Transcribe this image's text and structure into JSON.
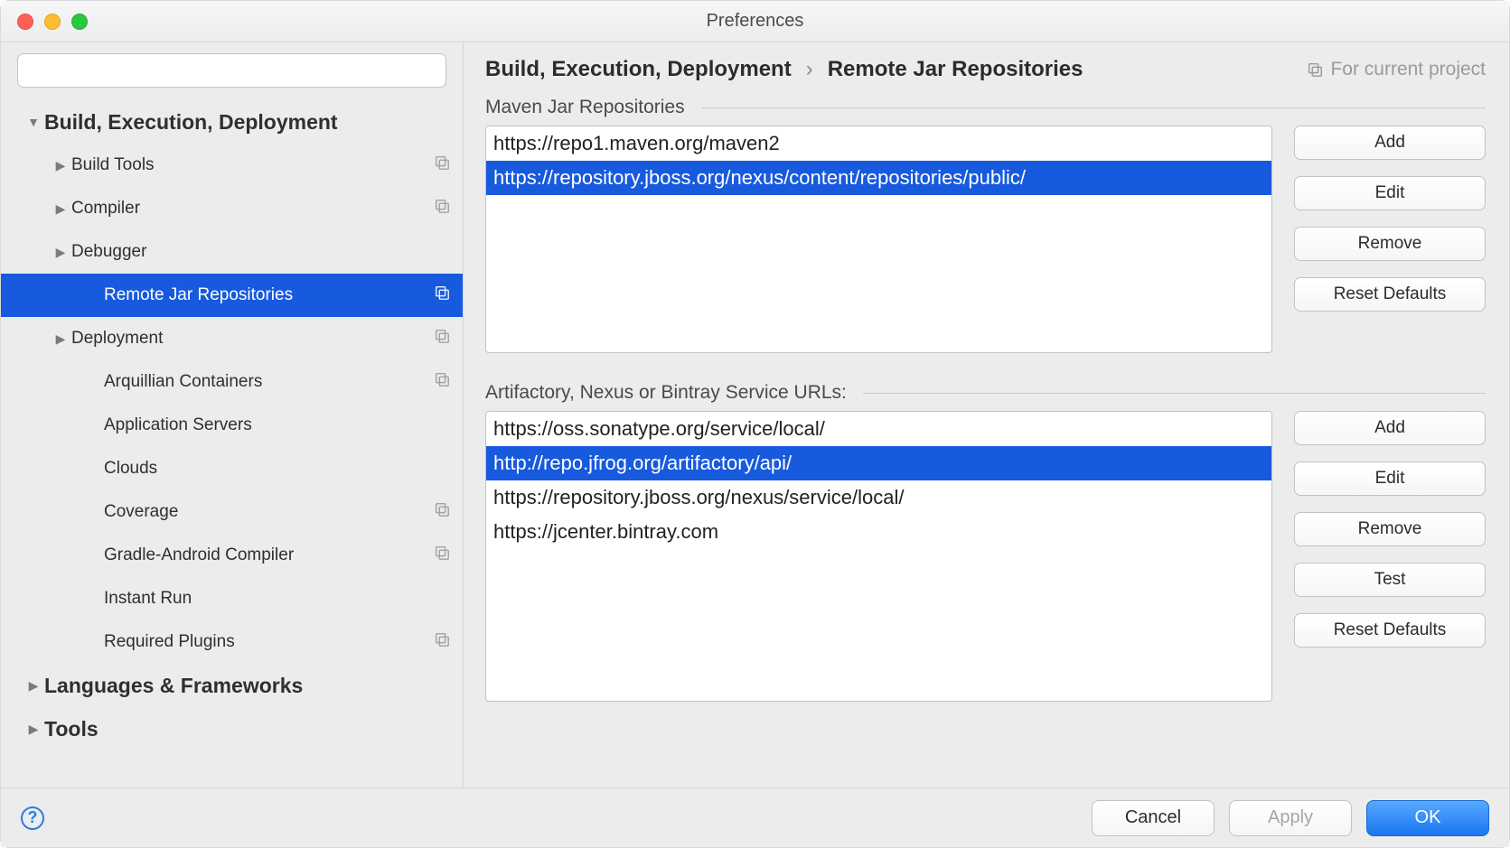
{
  "window": {
    "title": "Preferences"
  },
  "search": {
    "placeholder": ""
  },
  "sidebar": {
    "items": [
      {
        "label": "Build, Execution, Deployment",
        "bold": true,
        "expanded": true,
        "level": 0,
        "arrow": "down",
        "copy": false
      },
      {
        "label": "Build Tools",
        "level": 1,
        "arrow": "right",
        "copy": true
      },
      {
        "label": "Compiler",
        "level": 1,
        "arrow": "right",
        "copy": true
      },
      {
        "label": "Debugger",
        "level": 1,
        "arrow": "right",
        "copy": false
      },
      {
        "label": "Remote Jar Repositories",
        "level": 2,
        "arrow": "",
        "copy": true,
        "selected": true
      },
      {
        "label": "Deployment",
        "level": 1,
        "arrow": "right",
        "copy": true
      },
      {
        "label": "Arquillian Containers",
        "level": 2,
        "arrow": "",
        "copy": true
      },
      {
        "label": "Application Servers",
        "level": 2,
        "arrow": "",
        "copy": false
      },
      {
        "label": "Clouds",
        "level": 2,
        "arrow": "",
        "copy": false
      },
      {
        "label": "Coverage",
        "level": 2,
        "arrow": "",
        "copy": true
      },
      {
        "label": "Gradle-Android Compiler",
        "level": 2,
        "arrow": "",
        "copy": true
      },
      {
        "label": "Instant Run",
        "level": 2,
        "arrow": "",
        "copy": false
      },
      {
        "label": "Required Plugins",
        "level": 2,
        "arrow": "",
        "copy": true
      },
      {
        "label": "Languages & Frameworks",
        "bold": true,
        "level": 0,
        "arrow": "right",
        "copy": false
      },
      {
        "label": "Tools",
        "bold": true,
        "level": 0,
        "arrow": "right",
        "copy": false
      }
    ]
  },
  "breadcrumb": {
    "parent": "Build, Execution, Deployment",
    "current": "Remote Jar Repositories"
  },
  "scope": {
    "label": "For current project"
  },
  "sections": {
    "maven": {
      "title": "Maven Jar Repositories",
      "items": [
        {
          "url": "https://repo1.maven.org/maven2",
          "selected": false
        },
        {
          "url": "https://repository.jboss.org/nexus/content/repositories/public/",
          "selected": true
        }
      ],
      "buttons": {
        "add": "Add",
        "edit": "Edit",
        "remove": "Remove",
        "reset": "Reset Defaults"
      }
    },
    "services": {
      "title": "Artifactory, Nexus or Bintray Service URLs:",
      "items": [
        {
          "url": "https://oss.sonatype.org/service/local/",
          "selected": false
        },
        {
          "url": "http://repo.jfrog.org/artifactory/api/",
          "selected": true
        },
        {
          "url": "https://repository.jboss.org/nexus/service/local/",
          "selected": false
        },
        {
          "url": "https://jcenter.bintray.com",
          "selected": false
        }
      ],
      "buttons": {
        "add": "Add",
        "edit": "Edit",
        "remove": "Remove",
        "test": "Test",
        "reset": "Reset Defaults"
      }
    }
  },
  "footer": {
    "cancel": "Cancel",
    "apply": "Apply",
    "ok": "OK"
  }
}
